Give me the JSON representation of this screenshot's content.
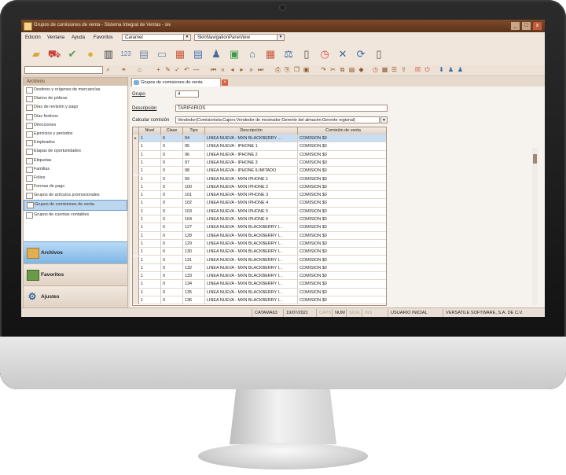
{
  "window": {
    "title": "Grupos de comisiones de venta - Sistema Integral de Ventas - siv",
    "controls": [
      "_",
      "□",
      "x"
    ]
  },
  "menubar": {
    "items": [
      "Edición",
      "Ventana",
      "Ayuda",
      "Favoritos"
    ],
    "theme_combo": "Caramel",
    "view_combo": "SkinNavigationPaneView"
  },
  "sidebar": {
    "header": "Archivos",
    "items": [
      "Destinos y orígenes de mercancías",
      "Diarios de pólizas",
      "Días de revisión y pago",
      "Días festivos",
      "Direcciones",
      "Ejercicios y periodos",
      "Empleados",
      "Etapas de oportunidades",
      "Etiquetas",
      "Familias",
      "Folios",
      "Formas de pago",
      "Grupos de artículos promocionales",
      "Grupos de comisiones de venta",
      "Grupos de cuentas contables"
    ],
    "selected_index": 13,
    "nav": {
      "archivos": "Archivos",
      "favoritos": "Favoritos",
      "ajustes": "Ajustes"
    }
  },
  "tab": {
    "label": "Grupos de comisiones de venta"
  },
  "form": {
    "grupo_label": "Grupo",
    "grupo_value": "4",
    "descripcion_label": "Descripción",
    "descripcion_value": "TARIFARIOS",
    "calcular_label": "Calcular comisión",
    "calcular_value": "Vendedor(Comisionista;Cajero;Vendedor de mostrador;Gerente del almacén;Gerente regional)"
  },
  "grid": {
    "columns": [
      "Nivel",
      "Clase",
      "Tipo",
      "Descripción",
      "Comisión de venta"
    ],
    "rows": [
      [
        "1",
        "0",
        "94",
        "LINEA NUEVA - MXN BLACKBERRY ...",
        "COMISION $0"
      ],
      [
        "1",
        "0",
        "95",
        "LINEA NUEVA - IPHONE 1",
        "COMISION $0"
      ],
      [
        "1",
        "0",
        "96",
        "LINEA NUEVA - IPHONE 2",
        "COMISION $0"
      ],
      [
        "1",
        "0",
        "97",
        "LINEA NUEVA - IPHONE 3",
        "COMISION $0"
      ],
      [
        "1",
        "0",
        "98",
        "LINEA NUEVA - IPHONE ILIMITADO",
        "COMISION $0"
      ],
      [
        "1",
        "0",
        "99",
        "LINEA NUEVA - MXN IPHONE 1",
        "COMISION $0"
      ],
      [
        "1",
        "0",
        "100",
        "LINEA NUEVA - MXN IPHONE 2",
        "COMISION $0"
      ],
      [
        "1",
        "0",
        "101",
        "LINEA NUEVA - MXN IPHONE 3",
        "COMISION $0"
      ],
      [
        "1",
        "0",
        "102",
        "LINEA NUEVA - MXN IPHONE 4",
        "COMISION $0"
      ],
      [
        "1",
        "0",
        "103",
        "LINEA NUEVA - MXN IPHONE 5",
        "COMISION $0"
      ],
      [
        "1",
        "0",
        "104",
        "LINEA NUEVA - MXN IPHONE 6",
        "COMISION $0"
      ],
      [
        "1",
        "0",
        "127",
        "LINEA NUEVA - MXN BLACKBERRY I...",
        "COMISION $0"
      ],
      [
        "1",
        "0",
        "128",
        "LINEA NUEVA - MXN BLACKBERRY I...",
        "COMISION $0"
      ],
      [
        "1",
        "0",
        "129",
        "LINEA NUEVA - MXN BLACKBERRY I...",
        "COMISION $0"
      ],
      [
        "1",
        "0",
        "130",
        "LINEA NUEVA - MXN BLACKBERRY I...",
        "COMISION $0"
      ],
      [
        "1",
        "0",
        "131",
        "LINEA NUEVA - MXN BLACKBERRY I...",
        "COMISION $0"
      ],
      [
        "1",
        "0",
        "132",
        "LINEA NUEVA - MXN BLACKBERRY I...",
        "COMISION $0"
      ],
      [
        "1",
        "0",
        "133",
        "LINEA NUEVA - MXN BLACKBERRY I...",
        "COMISION $0"
      ],
      [
        "1",
        "0",
        "134",
        "LINEA NUEVA - MXN BLACKBERRY I...",
        "COMISION $0"
      ],
      [
        "1",
        "0",
        "135",
        "LINEA NUEVA - MXN BLACKBERRY I...",
        "COMISION $0"
      ],
      [
        "1",
        "0",
        "136",
        "LINEA NUEVA - MXN BLACKBERRY I...",
        "COMISION $0"
      ]
    ],
    "selected_row": 0
  },
  "statusbar": {
    "user": "CATAMA63",
    "date": "19/07/2021",
    "caps": "CAPS",
    "num": "NUM",
    "scrl": "SCRL",
    "ins": "INS",
    "profile": "USUARIO INICIAL",
    "company": "VERSATILE SOFTWARE, S.A. DE C.V."
  },
  "toolbar_icons": [
    "folder-icon",
    "cart-icon",
    "check-icon",
    "coins-icon",
    "barcode-icon",
    "numbers-icon",
    "document-icon",
    "id-card-icon",
    "building-icon",
    "report-icon",
    "people-icon",
    "money-icon",
    "bank-icon",
    "calendar-icon",
    "scale-icon",
    "phone-icon",
    "clock-icon",
    "tools-icon",
    "refresh-icon",
    "mobile-icon"
  ],
  "colors": {
    "titlebar": "#6b3c20",
    "selection": "#c9def2",
    "nav_selected": "#8fc0ec"
  }
}
